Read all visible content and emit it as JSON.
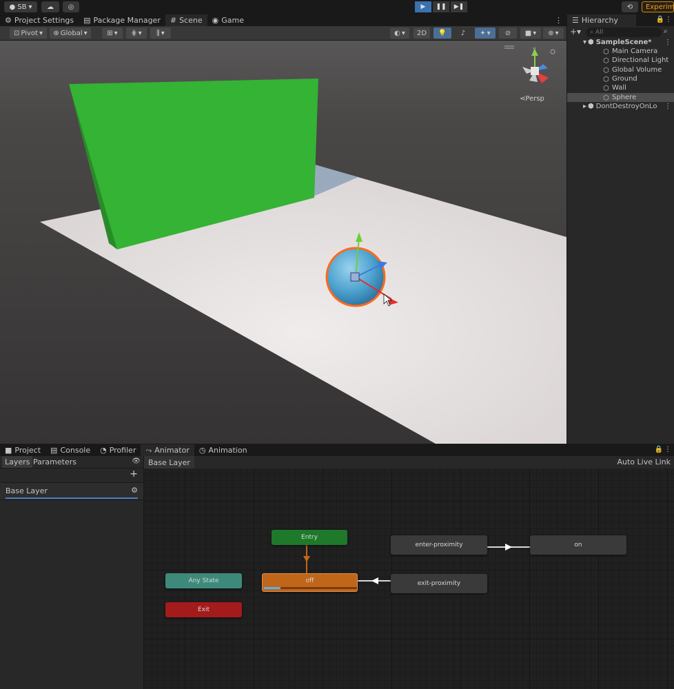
{
  "topbar": {
    "account": "SB",
    "experimental": "Experim"
  },
  "top_tabs": [
    {
      "label": "Project Settings",
      "icon": "gear-icon"
    },
    {
      "label": "Package Manager",
      "icon": "package-icon"
    },
    {
      "label": "Scene",
      "icon": "scene-grid-icon"
    },
    {
      "label": "Game",
      "icon": "gamepad-icon"
    }
  ],
  "scene_toolbar": {
    "pivot": "Pivot",
    "global": "Global",
    "mode_2d": "2D",
    "persp": "Persp",
    "gizmo_y": "y"
  },
  "hierarchy": {
    "title": "Hierarchy",
    "search_placeholder": "All",
    "scene": "SampleScene*",
    "items": [
      "Main Camera",
      "Directional Light",
      "Global Volume",
      "Ground",
      "Wall",
      "Sphere"
    ],
    "dontdestroy": "DontDestroyOnLo"
  },
  "bottom_tabs": [
    {
      "label": "Project",
      "icon": "folder-icon"
    },
    {
      "label": "Console",
      "icon": "console-icon"
    },
    {
      "label": "Profiler",
      "icon": "profiler-icon"
    },
    {
      "label": "Animator",
      "icon": "animator-icon"
    },
    {
      "label": "Animation",
      "icon": "animation-icon"
    }
  ],
  "animator": {
    "layers_tab": "Layers",
    "parameters_tab": "Parameters",
    "layer_name": "Base Layer",
    "breadcrumb": "Base Layer",
    "auto_live_link": "Auto Live Link",
    "progress": 0.18,
    "nodes": {
      "entry": "Entry",
      "any_state": "Any State",
      "exit": "Exit",
      "off": "off",
      "enter_proximity": "enter-proximity",
      "exit_proximity": "exit-proximity",
      "on": "on"
    }
  },
  "colors": {
    "accent": "#4a7dc4",
    "entry": "#1e7a2a",
    "any_state": "#3e8a7a",
    "exit": "#a31b1b",
    "off_state": "#c0661a",
    "wall": "#34b334",
    "ground": "#e4e0e0",
    "sphere": "#5aa8d0"
  }
}
